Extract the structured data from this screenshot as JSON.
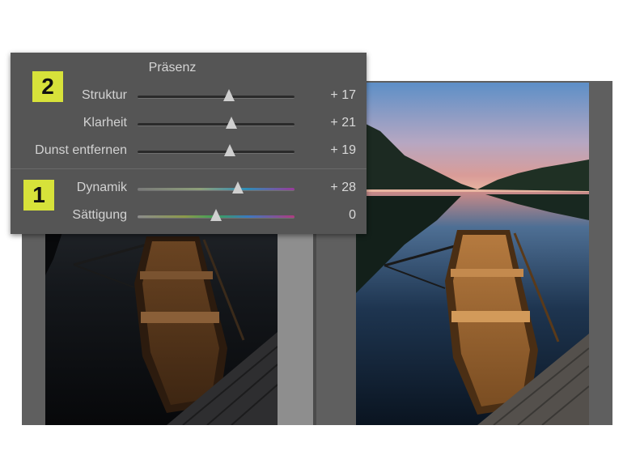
{
  "panel": {
    "title": "Präsenz",
    "sliders": [
      {
        "label": "Struktur",
        "value": "+ 17",
        "position": 0.58
      },
      {
        "label": "Klarheit",
        "value": "+ 21",
        "position": 0.6
      },
      {
        "label": "Dunst entfernen",
        "value": "+ 19",
        "position": 0.59
      },
      {
        "label": "Dynamik",
        "value": "+ 28",
        "position": 0.64
      },
      {
        "label": "Sättigung",
        "value": "0",
        "position": 0.5
      }
    ]
  },
  "badges": {
    "presence": "2",
    "color": "1"
  },
  "colors": {
    "badge": "#d7e23a",
    "panel_bg": "#555555",
    "frame": "#5f5f5f"
  }
}
